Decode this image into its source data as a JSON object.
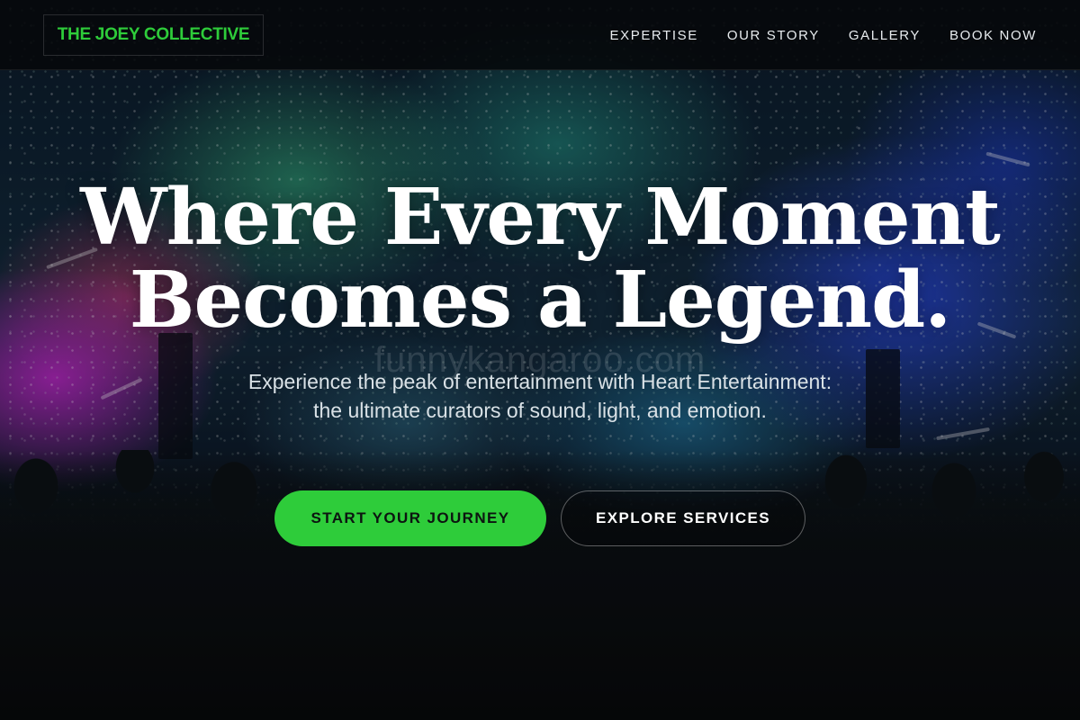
{
  "brand": {
    "logo_text": "THE JOEY COLLECTIVE",
    "accent_color": "#2ecc3a"
  },
  "nav": {
    "items": [
      {
        "label": "EXPERTISE"
      },
      {
        "label": "OUR STORY"
      },
      {
        "label": "GALLERY"
      },
      {
        "label": "BOOK NOW"
      }
    ]
  },
  "hero": {
    "title_line1": "Where Every Moment",
    "title_line2": "Becomes a Legend.",
    "subtitle": "Experience the peak of entertainment with Heart Entertainment: the ultimate curators of sound, light, and emotion.",
    "watermark": "funnykangaroo.com",
    "primary_cta": "START YOUR JOURNEY",
    "secondary_cta": "EXPLORE SERVICES",
    "background_image": "concert-crowd-photo"
  }
}
